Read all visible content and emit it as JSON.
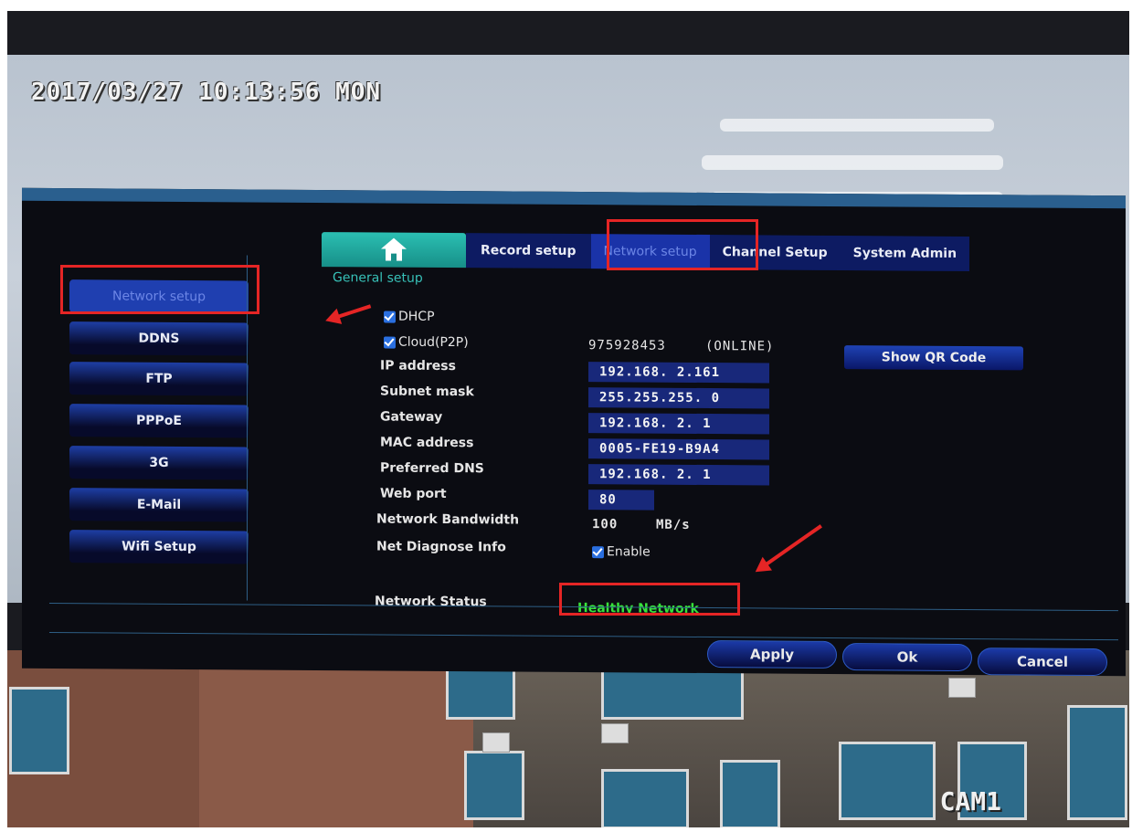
{
  "osd": {
    "timestamp": "2017/03/27 10:13:56 MON",
    "camera": "CAM1"
  },
  "tabs": [
    {
      "label": "Record setup"
    },
    {
      "label": "Network setup"
    },
    {
      "label": "Channel Setup"
    },
    {
      "label": "System Admin"
    }
  ],
  "section_title": "General setup",
  "sidebar": [
    {
      "label": "Network setup"
    },
    {
      "label": "DDNS"
    },
    {
      "label": "FTP"
    },
    {
      "label": "PPPoE"
    },
    {
      "label": "3G"
    },
    {
      "label": "E-Mail"
    },
    {
      "label": "Wifi Setup"
    }
  ],
  "form": {
    "dhcp_label": "DHCP",
    "cloud_label": "Cloud(P2P)",
    "cloud_id": "975928453",
    "cloud_status": "(ONLINE)",
    "qr_button": "Show QR Code",
    "ip_label": "IP address",
    "ip_value": "192.168.  2.161",
    "subnet_label": "Subnet mask",
    "subnet_value": "255.255.255.  0",
    "gateway_label": "Gateway",
    "gateway_value": "192.168.  2.  1",
    "mac_label": "MAC address",
    "mac_value": "0005-FE19-B9A4",
    "dns_label": "Preferred DNS",
    "dns_value": "192.168.  2.  1",
    "webport_label": "Web port",
    "webport_value": "80",
    "bandwidth_label": "Network Bandwidth",
    "bandwidth_value": "100",
    "bandwidth_unit": "MB/s",
    "diag_label": "Net Diagnose Info",
    "diag_enable": "Enable",
    "status_label": "Network Status",
    "status_value": "Healthy Network"
  },
  "buttons": {
    "apply": "Apply",
    "ok": "Ok",
    "cancel": "Cancel"
  },
  "colors": {
    "annotation": "#e52525",
    "status_ok": "#37e33b",
    "accent": "#2bbfb2"
  }
}
